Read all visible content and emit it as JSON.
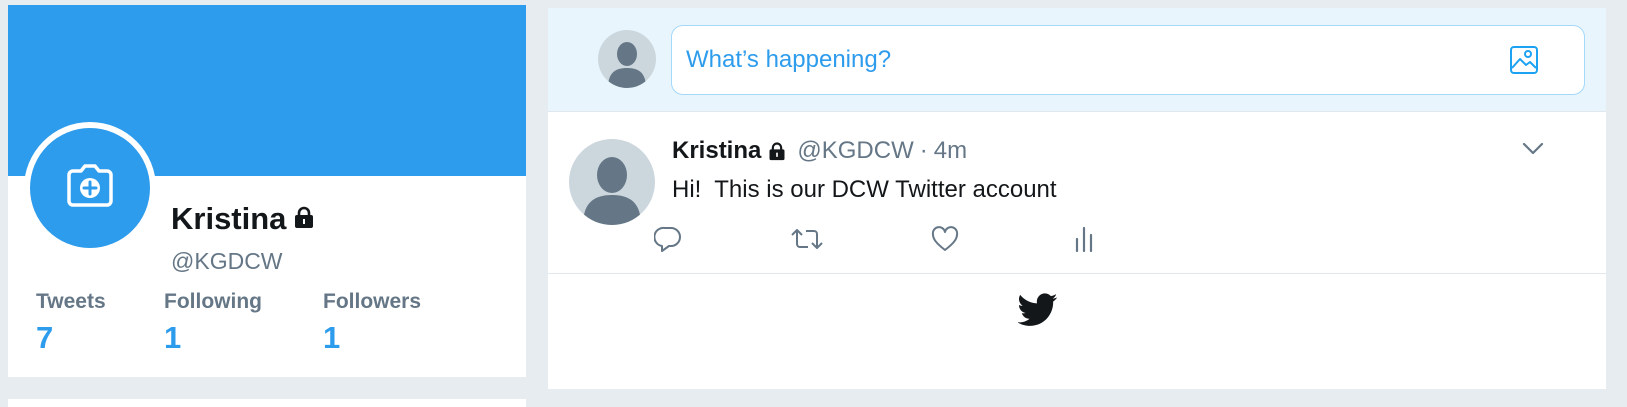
{
  "profile": {
    "name": "Kristina",
    "handle": "@KGDCW",
    "stats": [
      {
        "label": "Tweets",
        "value": "7"
      },
      {
        "label": "Following",
        "value": "1"
      },
      {
        "label": "Followers",
        "value": "1"
      }
    ],
    "banner_color": "#2e9cec"
  },
  "compose": {
    "placeholder": "What’s happening?"
  },
  "tweet": {
    "name": "Kristina",
    "handle": "@KGDCW",
    "separator": "·",
    "time": "4m",
    "text": "Hi!  This is our DCW Twitter account"
  },
  "icons": {
    "camera_add": "camera-add-icon",
    "lock": "lock-icon",
    "media": "image-icon",
    "caret": "chevron-down-icon",
    "reply": "reply-icon",
    "retweet": "retweet-icon",
    "like": "heart-icon",
    "analytics": "analytics-icon",
    "bird": "twitter-bird-icon"
  },
  "colors": {
    "accent": "#2e9cec",
    "muted": "#657786",
    "page_bg": "#e6ecf0"
  }
}
